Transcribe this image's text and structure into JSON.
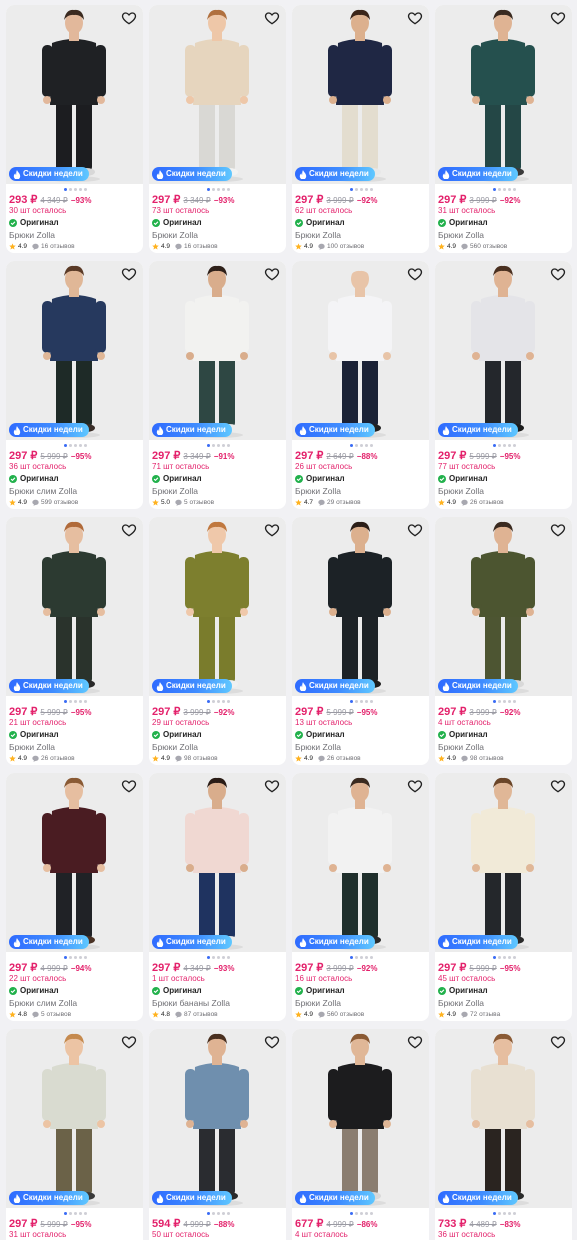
{
  "badge_label": "Скидки недели",
  "original_label": "Оригинал",
  "accent": "#e3216b",
  "badge_gradient": [
    "#2f6bff",
    "#5fc8ff"
  ],
  "products": [
    {
      "price": "293 ₽",
      "old_price": "4 349 ₽",
      "discount": "−93%",
      "stock": "30 шт осталось",
      "name": "Брюки Zolla",
      "rating": "4.9",
      "reviews": "16 отзывов",
      "top_color": "#1f2124",
      "bottom_color": "#1c1d20",
      "skin": "#e2b89b",
      "hair": "#3a2a20",
      "shoe": "#d8d8d8"
    },
    {
      "price": "297 ₽",
      "old_price": "3 349 ₽",
      "discount": "−93%",
      "stock": "73 шт осталось",
      "name": "Брюки Zolla",
      "rating": "4.9",
      "reviews": "16 отзывов",
      "top_color": "#e6d5be",
      "bottom_color": "#d9d8d4",
      "skin": "#eec7a8",
      "hair": "#b0703f",
      "shoe": "#f2f2f2"
    },
    {
      "price": "297 ₽",
      "old_price": "3 999 ₽",
      "discount": "−92%",
      "stock": "62 шт осталось",
      "name": "Брюки Zolla",
      "rating": "4.9",
      "reviews": "100 отзывов",
      "top_color": "#1f2744",
      "bottom_color": "#e3ddcf",
      "skin": "#dcb08e",
      "hair": "#3b2519",
      "shoe": "#e8e8e8"
    },
    {
      "price": "297 ₽",
      "old_price": "3 999 ₽",
      "discount": "−92%",
      "stock": "31 шт осталось",
      "name": "Брюки Zolla",
      "rating": "4.9",
      "reviews": "560 отзывов",
      "top_color": "#25504e",
      "bottom_color": "#244746",
      "skin": "#dfb393",
      "hair": "#3a2a20",
      "shoe": "#3a3a3a"
    },
    {
      "price": "297 ₽",
      "old_price": "5 999 ₽",
      "discount": "−95%",
      "stock": "36 шт осталось",
      "name": "Брюки слим Zolla",
      "rating": "4.9",
      "reviews": "599 отзывов",
      "top_color": "#26395e",
      "bottom_color": "#1e2a27",
      "skin": "#e0b797",
      "hair": "#5a3a26",
      "shoe": "#3a2e28"
    },
    {
      "price": "297 ₽",
      "old_price": "3 349 ₽",
      "discount": "−91%",
      "stock": "71 шт осталось",
      "name": "Брюки Zolla",
      "rating": "5.0",
      "reviews": "5 отзывов",
      "top_color": "#f2f2f0",
      "bottom_color": "#2e4743",
      "skin": "#d9ad8c",
      "hair": "#2e2019",
      "shoe": "#ececec"
    },
    {
      "price": "297 ₽",
      "old_price": "2 649 ₽",
      "discount": "−88%",
      "stock": "26 шт осталось",
      "name": "Брюки Zolla",
      "rating": "4.7",
      "reviews": "29 отзывов",
      "top_color": "#f4f4f6",
      "bottom_color": "#1b2236",
      "skin": "#e8c4a8",
      "hair": "#ececec",
      "shoe": "#222222"
    },
    {
      "price": "297 ₽",
      "old_price": "5 999 ₽",
      "discount": "−95%",
      "stock": "77 шт осталось",
      "name": "Брюки Zolla",
      "rating": "4.9",
      "reviews": "26 отзывов",
      "top_color": "#e4e4e8",
      "bottom_color": "#24272c",
      "skin": "#dfb393",
      "hair": "#4a3020",
      "shoe": "#1d1d1d"
    },
    {
      "price": "297 ₽",
      "old_price": "5 999 ₽",
      "discount": "−95%",
      "stock": "21 шт осталось",
      "name": "Брюки Zolla",
      "rating": "4.9",
      "reviews": "26 отзывов",
      "top_color": "#2c3a31",
      "bottom_color": "#2a332c",
      "skin": "#e6bea0",
      "hair": "#b06a3a",
      "shoe": "#2a2a2a"
    },
    {
      "price": "297 ₽",
      "old_price": "3 999 ₽",
      "discount": "−92%",
      "stock": "29 шт осталось",
      "name": "Брюки Zolla",
      "rating": "4.9",
      "reviews": "98 отзывов",
      "top_color": "#7d7f2e",
      "bottom_color": "#7a7c2c",
      "skin": "#efc8aa",
      "hair": "#c0783f",
      "shoe": "#f0f0f0"
    },
    {
      "price": "297 ₽",
      "old_price": "5 999 ₽",
      "discount": "−95%",
      "stock": "13 шт осталось",
      "name": "Брюки Zolla",
      "rating": "4.9",
      "reviews": "26 отзывов",
      "top_color": "#1c2226",
      "bottom_color": "#1d2226",
      "skin": "#dcb08e",
      "hair": "#2b1e18",
      "shoe": "#1e1e1e"
    },
    {
      "price": "297 ₽",
      "old_price": "3 999 ₽",
      "discount": "−92%",
      "stock": "4 шт осталось",
      "name": "Брюки Zolla",
      "rating": "4.9",
      "reviews": "98 отзывов",
      "top_color": "#4c5530",
      "bottom_color": "#4d5532",
      "skin": "#dfb393",
      "hair": "#3a2a20",
      "shoe": "#d9d9d9"
    },
    {
      "price": "297 ₽",
      "old_price": "4 999 ₽",
      "discount": "−94%",
      "stock": "22 шт осталось",
      "name": "Брюки слим Zolla",
      "rating": "4.8",
      "reviews": "5 отзывов",
      "top_color": "#4a1c22",
      "bottom_color": "#202226",
      "skin": "#e6bea0",
      "hair": "#8a5a34",
      "shoe": "#4a3224"
    },
    {
      "price": "297 ₽",
      "old_price": "4 349 ₽",
      "discount": "−93%",
      "stock": "1 шт осталось",
      "name": "Брюки бананы Zolla",
      "rating": "4.8",
      "reviews": "87 отзывов",
      "top_color": "#f0d8d2",
      "bottom_color": "#1f3360",
      "skin": "#d9ad8c",
      "hair": "#2a1c16",
      "shoe": "#ececec"
    },
    {
      "price": "297 ₽",
      "old_price": "3 999 ₽",
      "discount": "−92%",
      "stock": "16 шт осталось",
      "name": "Брюки Zolla",
      "rating": "4.9",
      "reviews": "560 отзывов",
      "top_color": "#f2f2f2",
      "bottom_color": "#1f2f2c",
      "skin": "#dfb393",
      "hair": "#3a2a20",
      "shoe": "#2a2a2a"
    },
    {
      "price": "297 ₽",
      "old_price": "5 999 ₽",
      "discount": "−95%",
      "stock": "45 шт осталось",
      "name": "Брюки Zolla",
      "rating": "4.9",
      "reviews": "72 отзыва",
      "top_color": "#f1ead8",
      "bottom_color": "#24272b",
      "skin": "#e0b797",
      "hair": "#6a4528",
      "shoe": "#2a2a2a"
    },
    {
      "price": "297 ₽",
      "old_price": "5 999 ₽",
      "discount": "−95%",
      "stock": "31 шт осталось",
      "name": "",
      "rating": "",
      "reviews": "",
      "top_color": "#d9dbd0",
      "bottom_color": "#6b6248",
      "skin": "#ecc4a4",
      "hair": "#c58a4e",
      "shoe": "#3a3a3a"
    },
    {
      "price": "594 ₽",
      "old_price": "4 999 ₽",
      "discount": "−88%",
      "stock": "50 шт осталось",
      "name": "",
      "rating": "",
      "reviews": "",
      "top_color": "#6f8fae",
      "bottom_color": "#2a2c30",
      "skin": "#dfb393",
      "hair": "#4a3020",
      "shoe": "#2a2a2a"
    },
    {
      "price": "677 ₽",
      "old_price": "4 999 ₽",
      "discount": "−86%",
      "stock": "4 шт осталось",
      "name": "",
      "rating": "",
      "reviews": "",
      "top_color": "#1c1c1e",
      "bottom_color": "#8a7d70",
      "skin": "#e0b797",
      "hair": "#8a5a34",
      "shoe": "#d9d9d9"
    },
    {
      "price": "733 ₽",
      "old_price": "4 489 ₽",
      "discount": "−83%",
      "stock": "36 шт осталось",
      "name": "",
      "rating": "",
      "reviews": "",
      "top_color": "#e8e0d2",
      "bottom_color": "#2a2420",
      "skin": "#e6bea0",
      "hair": "#8a5a34",
      "shoe": "#2a2a2a"
    }
  ]
}
